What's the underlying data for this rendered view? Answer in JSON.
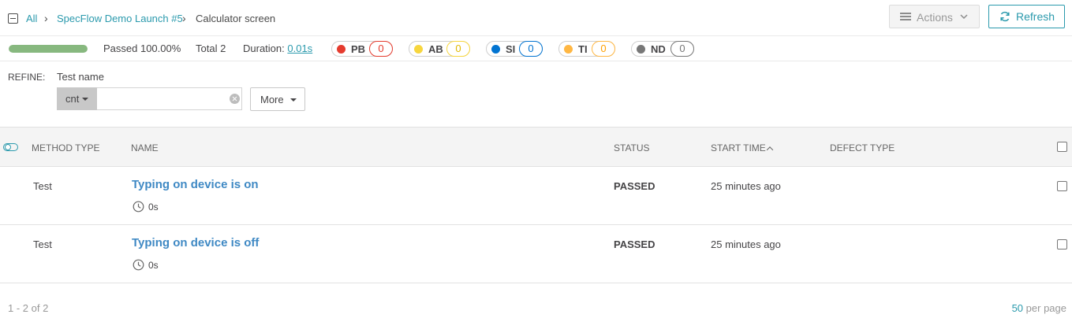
{
  "breadcrumb": {
    "items": [
      "All",
      "SpecFlow Demo Launch #5",
      "Calculator screen"
    ]
  },
  "header": {
    "actions_label": "Actions",
    "refresh_label": "Refresh"
  },
  "stats": {
    "progress_percent": 100,
    "passed_text": "Passed 100.00%",
    "total_text": "Total 2",
    "duration_label": "Duration:",
    "duration_value": "0.01s",
    "defects": [
      {
        "code": "PB",
        "count": "0",
        "color": "#e53b2e"
      },
      {
        "code": "AB",
        "count": "0",
        "color": "#f7d63e"
      },
      {
        "code": "SI",
        "count": "0",
        "color": "#0274d1"
      },
      {
        "code": "TI",
        "count": "0",
        "color": "#ffb743"
      },
      {
        "code": "ND",
        "count": "0",
        "color": "#777777"
      }
    ]
  },
  "refine": {
    "label": "REFINE:",
    "field_label": "Test name",
    "condition": "cnt",
    "input_value": "",
    "input_placeholder": "",
    "more_label": "More"
  },
  "table": {
    "columns": [
      "METHOD TYPE",
      "NAME",
      "STATUS",
      "START TIME",
      "DEFECT TYPE"
    ],
    "sort_column": "START TIME",
    "rows": [
      {
        "method_type": "Test",
        "name": "Typing on device is on",
        "duration": "0s",
        "status": "PASSED",
        "start_time": "25 minutes ago",
        "defect_type": ""
      },
      {
        "method_type": "Test",
        "name": "Typing on device is off",
        "duration": "0s",
        "status": "PASSED",
        "start_time": "25 minutes ago",
        "defect_type": ""
      }
    ]
  },
  "footer": {
    "range_text": "1 - 2 of 2",
    "per_page_value": "50",
    "per_page_label": "per page"
  },
  "colors": {
    "accent": "#2b9aad",
    "link": "#3f89c4",
    "progress_passed": "#87b87f"
  }
}
